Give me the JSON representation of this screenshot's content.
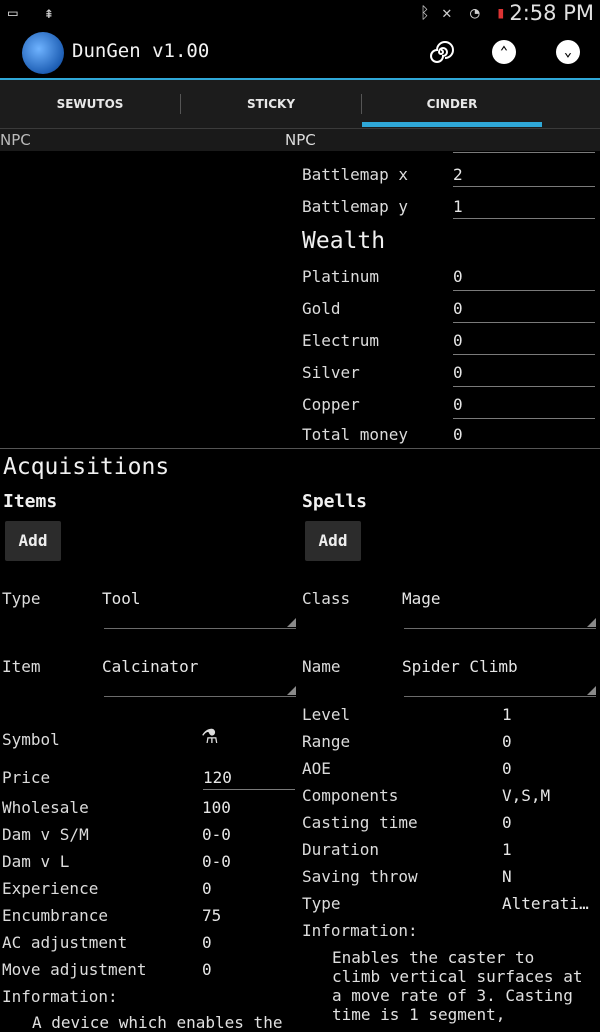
{
  "status_bar": {
    "time": "2:58 PM"
  },
  "app": {
    "title": "DunGen v1.00"
  },
  "tabs": [
    {
      "label": "SEWUTOS"
    },
    {
      "label": "STICKY"
    },
    {
      "label": "CINDER"
    }
  ],
  "npc_row": {
    "left": "NPC",
    "right": "NPC"
  },
  "battlemap": {
    "x_label": "Battlemap x",
    "x_value": "2",
    "y_label": "Battlemap y",
    "y_value": "1"
  },
  "wealth": {
    "heading": "Wealth",
    "rows": [
      {
        "label": "Platinum",
        "value": "0"
      },
      {
        "label": "Gold",
        "value": "0"
      },
      {
        "label": "Electrum",
        "value": "0"
      },
      {
        "label": "Silver",
        "value": "0"
      },
      {
        "label": "Copper",
        "value": "0"
      }
    ],
    "total_label": "Total money",
    "total_value": "0"
  },
  "acquisitions": {
    "heading": "Acquisitions",
    "items": {
      "heading": "Items",
      "add_label": "Add",
      "type_label": "Type",
      "type_value": "Tool",
      "item_label": "Item",
      "item_value": "Calcinator",
      "symbol_label": "Symbol",
      "symbol_glyph": "⚗",
      "price_label": "Price",
      "price_value": "120",
      "stats": [
        {
          "label": "Wholesale",
          "value": "100"
        },
        {
          "label": "Dam v S/M",
          "value": "0-0"
        },
        {
          "label": "Dam v L",
          "value": "0-0"
        },
        {
          "label": "Experience",
          "value": "0"
        },
        {
          "label": "Encumbrance",
          "value": "75"
        },
        {
          "label": "AC adjustment",
          "value": "0"
        },
        {
          "label": "Move adjustment",
          "value": "0"
        }
      ],
      "info_label": "Information:",
      "info_text": "A device which enables the"
    },
    "spells": {
      "heading": "Spells",
      "add_label": "Add",
      "class_label": "Class",
      "class_value": "Mage",
      "name_label": "Name",
      "name_value": "Spider Climb",
      "stats": [
        {
          "label": "Level",
          "value": "1"
        },
        {
          "label": "Range",
          "value": "0"
        },
        {
          "label": "AOE",
          "value": "0"
        },
        {
          "label": "Components",
          "value": "V,S,M"
        },
        {
          "label": "Casting time",
          "value": "0"
        },
        {
          "label": "Duration",
          "value": "1"
        },
        {
          "label": "Saving throw",
          "value": "N"
        },
        {
          "label": "Type",
          "value": "Alterati…"
        }
      ],
      "info_label": "Information:",
      "info_lines": [
        "Enables the caster to",
        "climb vertical surfaces at",
        "a move rate of 3. Casting",
        "time is 1 segment,"
      ]
    }
  },
  "colors": {
    "accent": "#2fa8d8",
    "background": "#000000",
    "tabbar": "#1c1c1c"
  }
}
